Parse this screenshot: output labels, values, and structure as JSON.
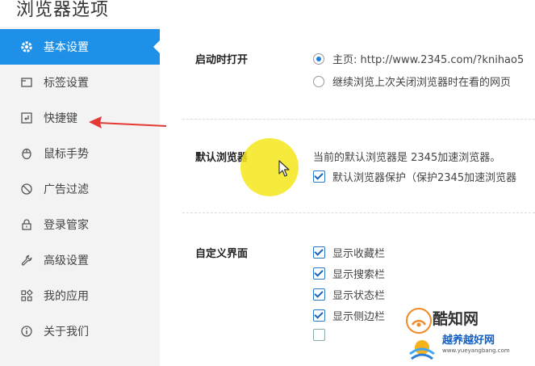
{
  "window": {
    "title": "浏览器选项"
  },
  "sidebar": {
    "items": [
      {
        "label": "基本设置",
        "icon": "gear-icon"
      },
      {
        "label": "标签设置",
        "icon": "tabs-icon"
      },
      {
        "label": "快捷键",
        "icon": "keyboard-shortcut-icon"
      },
      {
        "label": "鼠标手势",
        "icon": "mouse-icon"
      },
      {
        "label": "广告过滤",
        "icon": "block-icon"
      },
      {
        "label": "登录管家",
        "icon": "lock-icon"
      },
      {
        "label": "高级设置",
        "icon": "wrench-icon"
      },
      {
        "label": "我的应用",
        "icon": "apps-grid-icon"
      },
      {
        "label": "关于我们",
        "icon": "info-icon"
      }
    ],
    "active_index": 0
  },
  "startup": {
    "label": "启动时打开",
    "option_homepage": "主页: http://www.2345.com/?knihao5",
    "option_continue": "继续浏览上次关闭浏览器时在看的网页"
  },
  "default_browser": {
    "label": "默认浏览器",
    "status": "当前的默认浏览器是 2345加速浏览器。",
    "protect": "默认浏览器保护（保护2345加速浏览器"
  },
  "custom_ui": {
    "label": "自定义界面",
    "options": [
      {
        "label": "显示收藏栏",
        "checked": true
      },
      {
        "label": "显示搜索栏",
        "checked": true
      },
      {
        "label": "显示状态栏",
        "checked": true
      },
      {
        "label": "显示侧边栏",
        "checked": true
      },
      {
        "label": "",
        "checked": false
      }
    ]
  },
  "watermark": {
    "brand": "酷知网",
    "site": "越养越好网",
    "url": "www.yueyangbang.com"
  },
  "colors": {
    "accent": "#1e90e8",
    "annotation_arrow": "#e53935",
    "cursor_highlight": "#f4e61a"
  }
}
